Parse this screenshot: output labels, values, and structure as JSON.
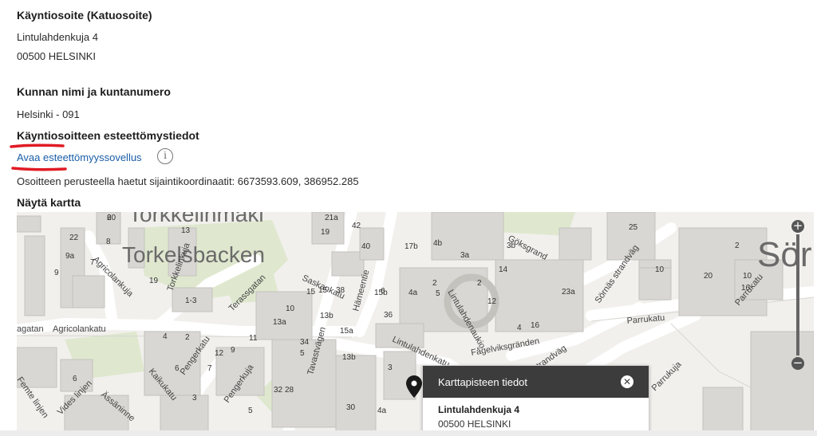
{
  "visiting_address": {
    "heading": "Käyntiosoite (Katuosoite)",
    "street": "Lintulahdenkuja 4",
    "postal": "00500 HELSINKI"
  },
  "municipality": {
    "heading": "Kunnan nimi ja kuntanumero",
    "value": "Helsinki - 091"
  },
  "accessibility": {
    "heading": "Käyntiosoitteen esteettömystiedot",
    "link": "Avaa esteettömyyssovellus",
    "info_icon": "info-icon",
    "annotation_color": "#e01b24"
  },
  "coordinates": {
    "text": "Osoitteen perusteella haetut sijaintikoordinaatit: 6673593.609, 386952.285"
  },
  "map_section": {
    "heading": "Näytä kartta",
    "zoom_in": "+",
    "zoom_out": "−",
    "marker_icon": "map-pin-icon",
    "labels": {
      "area_torkkeli": "Torkkelinmäki",
      "area_torkelsbacken": "Torkelsbacken",
      "area_sor": "Sör",
      "street_agricolankatu": "Agricolankatu",
      "street_agricolankuja": "Agricolankuja",
      "street_torkkelinkuja": "Torkkelinkuja",
      "street_terassikatu": "Terassgatan",
      "street_saskankatu": "Saskankatu",
      "street_haemeentie": "Hämeentie",
      "street_tavastvaegen": "Tavastvägen",
      "street_lintulahdenkatu": "Lintulahdenkatu",
      "street_lintulahdenaukio": "Lintulahdenaukio",
      "street_goksgrand": "Göksgrand",
      "street_soernaes_strandvaeg": "Sörnäs strandväg",
      "street_parrukatu": "Parrukatu",
      "street_parrukuja": "Parrukuja",
      "street_pengerkatu": "Pengerkatu",
      "street_pengerkuja": "Pengerkuja",
      "street_kaikukatu": "Kaikukatu",
      "street_assaninne": "Ässäninne",
      "street_vides": "Vides linjen",
      "street_femte": "Femte linjen",
      "street_agatan": "agatan",
      "street_strandvag": "strandväg",
      "street_helsinkigranden": "Fågelviksgränden"
    },
    "numbers": [
      "20",
      "21a",
      "42",
      "4b",
      "3a",
      "3b",
      "22",
      "19",
      "13",
      "40",
      "17b",
      "14",
      "25",
      "9a",
      "8",
      "15",
      "38",
      "6",
      "10",
      "2",
      "7",
      "9",
      "19",
      "4a",
      "12",
      "20",
      "2",
      "1-3",
      "15",
      "15b",
      "23a",
      "5",
      "16",
      "10",
      "13b",
      "36",
      "15a",
      "4",
      "2",
      "6",
      "7",
      "9",
      "11",
      "13a",
      "34",
      "6",
      "12",
      "5",
      "32",
      "13b",
      "3",
      "3",
      "5",
      "28",
      "30",
      "4a",
      "4",
      "10",
      "16",
      "2",
      "6"
    ]
  },
  "popup": {
    "title": "Karttapisteen tiedot",
    "close_icon": "close-icon",
    "street": "Lintulahdenkuja 4",
    "postal": "00500 HELSINKI"
  }
}
